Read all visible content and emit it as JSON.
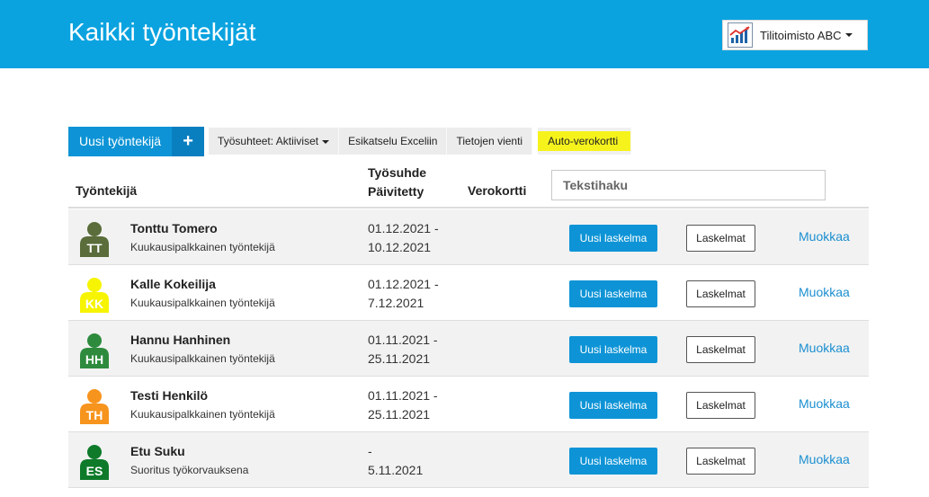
{
  "header": {
    "title": "Kaikki työntekijät",
    "company": "Tilitoimisto ABC",
    "company_logo_icon": "bar-chart-logo-icon"
  },
  "toolbar": {
    "new_employee": "Uusi työntekijä",
    "plus": "+",
    "employment_filter": "Työsuhteet: Aktiiviset",
    "excel_preview": "Esikatselu Exceliin",
    "data_export": "Tietojen vienti",
    "auto_tax_card": "Auto-verokortti"
  },
  "table": {
    "col_employee": "Työntekijä",
    "col_employment_line1": "Työsuhde",
    "col_employment_line2": "Päivitetty",
    "col_tax_card": "Verokortti",
    "search_placeholder": "Tekstihaku"
  },
  "actions": {
    "new_calc": "Uusi laskelma",
    "calcs": "Laskelmat",
    "edit": "Muokkaa"
  },
  "employees": [
    {
      "initials": "TT",
      "name": "Tonttu Tomero",
      "type": "Kuukausipalkkainen työntekijä",
      "period_start": "01.12.2021 -",
      "period_end": "10.12.2021",
      "color": "#5a6d3a"
    },
    {
      "initials": "KK",
      "name": "Kalle Kokeilija",
      "type": "Kuukausipalkkainen työntekijä",
      "period_start": "01.12.2021 -",
      "period_end": "7.12.2021",
      "color": "#f6f400"
    },
    {
      "initials": "HH",
      "name": "Hannu Hanhinen",
      "type": "Kuukausipalkkainen työntekijä",
      "period_start": "01.11.2021 -",
      "period_end": "25.11.2021",
      "color": "#2e8b3e"
    },
    {
      "initials": "TH",
      "name": "Testi Henkilö",
      "type": "Kuukausipalkkainen työntekijä",
      "period_start": "01.11.2021 -",
      "period_end": "25.11.2021",
      "color": "#f7941d"
    },
    {
      "initials": "ES",
      "name": "Etu Suku",
      "type": "Suoritus työkorvauksena",
      "period_start": "-",
      "period_end": "5.11.2021",
      "color": "#0e7a2a"
    }
  ],
  "colors": {
    "header_bg": "#0aa3e0",
    "primary_button": "#0e94d6",
    "link": "#1b8fd0",
    "highlight": "#f6f31c"
  }
}
